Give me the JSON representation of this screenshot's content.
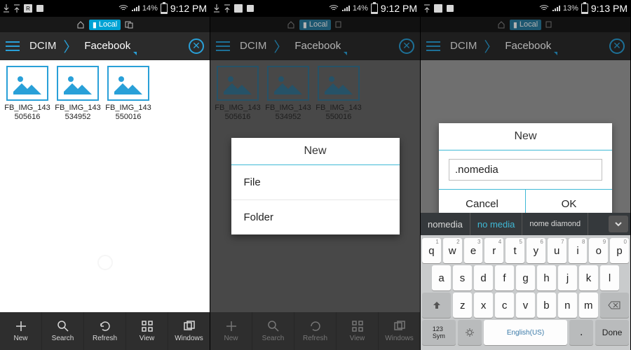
{
  "status": {
    "battery1": "14%",
    "battery2": "14%",
    "battery3": "13%",
    "time1": "9:12 PM",
    "time2": "9:12 PM",
    "time3": "9:13 PM"
  },
  "tabs": {
    "local": "Local"
  },
  "breadcrumb": {
    "root": "DCIM",
    "current": "Facebook"
  },
  "files": [
    {
      "name": "FB_IMG_143505616"
    },
    {
      "name": "FB_IMG_143534952"
    },
    {
      "name": "FB_IMG_143550016"
    }
  ],
  "toolbar": {
    "new": "New",
    "search": "Search",
    "refresh": "Refresh",
    "view": "View",
    "windows": "Windows"
  },
  "dialog_new": {
    "title": "New",
    "opt_file": "File",
    "opt_folder": "Folder"
  },
  "dialog_name": {
    "title": "New",
    "value": ".nomedia",
    "cancel": "Cancel",
    "ok": "OK"
  },
  "suggestions": {
    "s1": "nomedia",
    "s2": "no media",
    "s3": "nome diamond"
  },
  "keyboard": {
    "row1": [
      "q",
      "w",
      "e",
      "r",
      "t",
      "y",
      "u",
      "i",
      "o",
      "p"
    ],
    "row1_hints": [
      "1",
      "2",
      "3",
      "4",
      "5",
      "6",
      "7",
      "8",
      "9",
      "0"
    ],
    "row2": [
      "a",
      "s",
      "d",
      "f",
      "g",
      "h",
      "j",
      "k",
      "l"
    ],
    "row3": [
      "z",
      "x",
      "c",
      "v",
      "b",
      "n",
      "m"
    ],
    "sym": "123\nSym",
    "lang": "English(US)",
    "done": "Done"
  }
}
